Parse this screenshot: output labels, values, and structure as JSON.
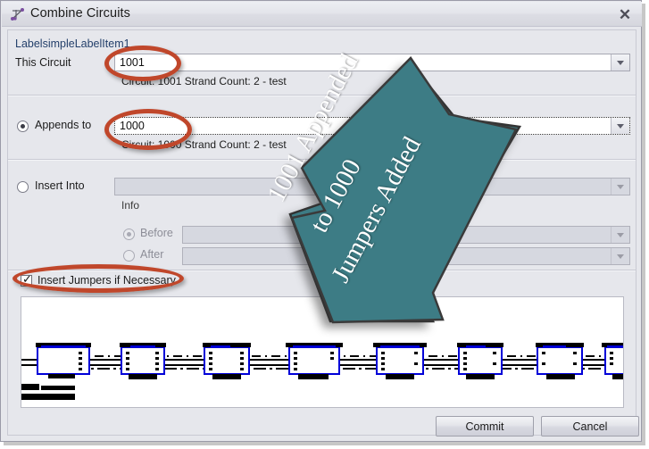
{
  "window": {
    "title": "Combine Circuits",
    "icon": "circuit-node-icon",
    "close_label": "✕"
  },
  "form": {
    "top_label": "LabelsimpleLabelItem1",
    "this_circuit": {
      "label": "This Circuit",
      "value": "1001",
      "info": "Circuit: 1001 Strand Count: 2 - test"
    },
    "appends_to": {
      "label": "Appends to",
      "value": "1000",
      "info": "Circuit: 1000 Strand Count: 2 - test",
      "selected": true
    },
    "insert_into": {
      "label": "Insert Into",
      "value": "",
      "info": "Info",
      "selected": false
    },
    "before": {
      "label": "Before",
      "value": "",
      "selected": true,
      "enabled": false
    },
    "after": {
      "label": "After",
      "value": "",
      "selected": false,
      "enabled": false
    },
    "insert_jumpers": {
      "label": "Insert Jumpers if Necessary",
      "checked": true,
      "check_glyph": "✓"
    }
  },
  "footer": {
    "commit_label": "Commit",
    "cancel_label": "Cancel"
  },
  "annotation": {
    "arrow_text_lines": [
      "1001 Appended",
      "to 1000",
      "Jumpers Added"
    ],
    "arrow_color": "#3d7c85",
    "highlight_color": "#c0472b",
    "highlights": [
      "this-circuit-value",
      "appends-to-value",
      "insert-jumpers-checkbox"
    ]
  },
  "diagram": {
    "description": "circuit strand schematic",
    "device_count": 8,
    "node_color": "#0000d8"
  }
}
